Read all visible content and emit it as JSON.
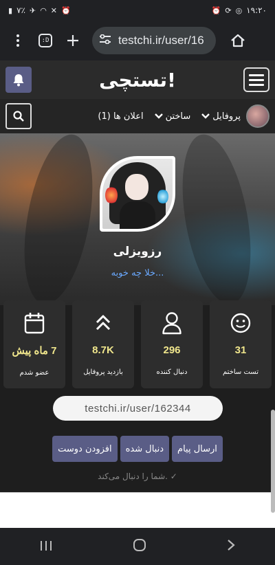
{
  "status_bar": {
    "time": "۱۹:۲۰",
    "battery": "٧٪"
  },
  "browser": {
    "url": "testchi.ir/user/16",
    "tab_count": ":D"
  },
  "site": {
    "logo": "تستچی!"
  },
  "nav": {
    "profile": "پروفایل",
    "build": "ساختن",
    "notifications": "اعلان ها (1)"
  },
  "profile": {
    "username": "رزویزلی",
    "bio": "خلا چه خوبه..."
  },
  "stats": [
    {
      "value": "31",
      "label": "تست ساختم",
      "icon": "smiley-icon"
    },
    {
      "value": "296",
      "label": "دنبال کننده",
      "icon": "user-icon"
    },
    {
      "value": "8.7K",
      "label": "بازدید پروفایل",
      "icon": "chevrons-up-icon"
    },
    {
      "value": "7 ماه پیش",
      "label": "عضو شدم",
      "icon": "calendar-icon"
    }
  ],
  "profile_link": "testchi.ir/user/162344",
  "actions": {
    "send_message": "ارسال پیام",
    "followed": "دنبال شده",
    "add_friend": "افزودن دوست"
  },
  "follow_note": "شما را دنبال می‌کند."
}
